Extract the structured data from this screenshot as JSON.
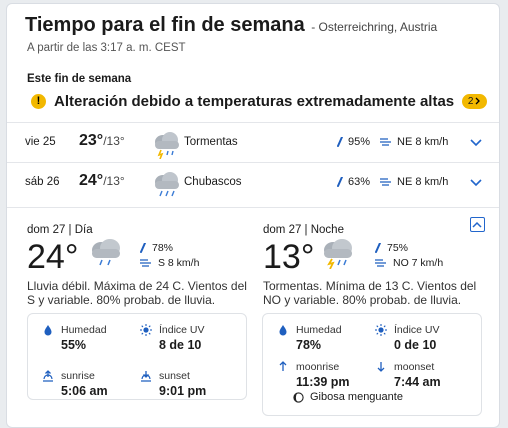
{
  "header": {
    "title": "Tiempo para el fin de semana",
    "location": "- Osterreichring, Austria",
    "as_of": "A partir de las 3:17 a. m. CEST"
  },
  "weekend_label": "Este fin de semana",
  "alert": {
    "icon": "exclamation-icon",
    "text": "Alteración debido a temperaturas extremadamente altas",
    "count": "2",
    "color": "#f2b800"
  },
  "days": [
    {
      "day": "vie 25",
      "high": "23°",
      "low": "/13°",
      "icon": "thunderstorm-icon",
      "condition": "Tormentas",
      "precip": "95%",
      "wind": "NE 8 km/h"
    },
    {
      "day": "sáb 26",
      "high": "24°",
      "low": "/13°",
      "icon": "showers-icon",
      "condition": "Chubascos",
      "precip": "63%",
      "wind": "NE 8 km/h"
    }
  ],
  "detail": {
    "day": {
      "header": "dom 27 | Día",
      "temp": "24°",
      "precip": "78%",
      "wind": "S 8 km/h",
      "description": "Lluvia débil. Máxima de 24 C. Vientos del S y variable. 80% probab. de lluvia.",
      "humidity_label": "Humedad",
      "humidity": "55%",
      "uv_label": "Índice UV",
      "uv": "8 de 10",
      "rise_label": "sunrise",
      "rise": "5:06 am",
      "set_label": "sunset",
      "set": "9:01 pm"
    },
    "night": {
      "header": "dom 27 | Noche",
      "temp": "13°",
      "precip": "75%",
      "wind": "NO 7 km/h",
      "description": "Tormentas. Mínima de 13 C. Vientos del NO y variable. 80% probab. de lluvia.",
      "humidity_label": "Humedad",
      "humidity": "78%",
      "uv_label": "Índice UV",
      "uv": "0 de 10",
      "rise_label": "moonrise",
      "rise": "11:39 pm",
      "set_label": "moonset",
      "set": "7:44 am",
      "moon_phase": "Gibosa menguante"
    }
  },
  "colors": {
    "accent": "#2266cc",
    "alert": "#f2b800"
  }
}
